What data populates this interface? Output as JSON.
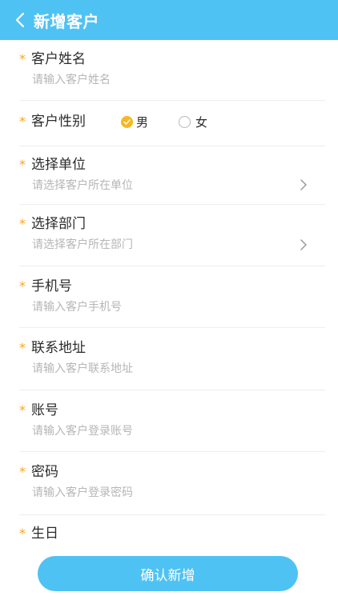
{
  "header": {
    "title": "新增客户",
    "back_icon": "chevron-left-icon",
    "background_color": "#4fc2f4"
  },
  "form": {
    "required_mark": "*",
    "fields": {
      "name": {
        "label": "客户姓名",
        "placeholder": "请输入客户姓名"
      },
      "gender": {
        "label": "客户性别",
        "options": [
          {
            "label": "男",
            "selected": true
          },
          {
            "label": "女",
            "selected": false
          }
        ]
      },
      "unit": {
        "label": "选择单位",
        "placeholder": "请选择客户所在单位"
      },
      "department": {
        "label": "选择部门",
        "placeholder": "请选择客户所在部门"
      },
      "phone": {
        "label": "手机号",
        "placeholder": "请输入客户手机号"
      },
      "address": {
        "label": "联系地址",
        "placeholder": "请输入客户联系地址"
      },
      "account": {
        "label": "账号",
        "placeholder": "请输入客户登录账号"
      },
      "password": {
        "label": "密码",
        "placeholder": "请输入客户登录密码"
      },
      "birthday": {
        "label": "生日"
      }
    }
  },
  "actions": {
    "confirm_label": "确认新增"
  },
  "colors": {
    "accent": "#4fc2f4",
    "required": "#f5a623",
    "radio_selected": "#f5b820",
    "placeholder": "#b6b6b6"
  }
}
